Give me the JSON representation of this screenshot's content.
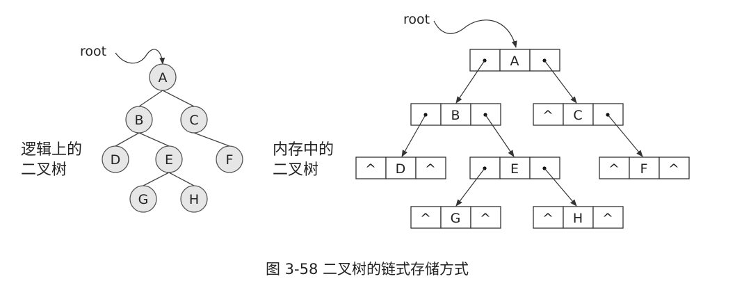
{
  "root_label": "root",
  "logical_tree": {
    "title_line1": "逻辑上的",
    "title_line2": "二叉树",
    "nodes": [
      "A",
      "B",
      "C",
      "D",
      "E",
      "F",
      "G",
      "H"
    ]
  },
  "memory_tree": {
    "title_line1": "内存中的",
    "title_line2": "二叉树",
    "null_symbol": "^",
    "nodes": [
      "A",
      "B",
      "C",
      "D",
      "E",
      "F",
      "G",
      "H"
    ]
  },
  "caption": "图 3-58  二叉树的链式存储方式"
}
